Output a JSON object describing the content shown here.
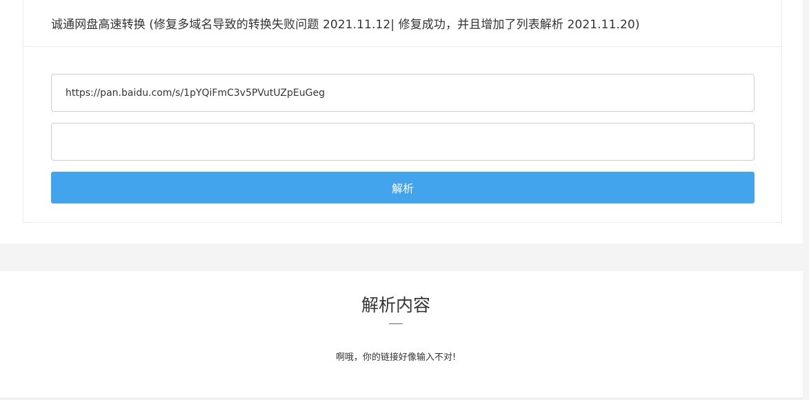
{
  "panel": {
    "title": "诚通网盘高速转换 (修复多域名导致的转换失败问题 2021.11.12| 修复成功，并且增加了列表解析 2021.11.20)"
  },
  "form": {
    "url_value": "https://pan.baidu.com/s/1pYQiFmC3v5PVutUZpEuGeg",
    "password_value": "",
    "parse_button_label": "解析"
  },
  "result": {
    "heading": "解析内容",
    "message": "啊哦，你的链接好像输入不对!"
  },
  "colors": {
    "button": "#42a4ec",
    "band": "#f4f4f4"
  }
}
